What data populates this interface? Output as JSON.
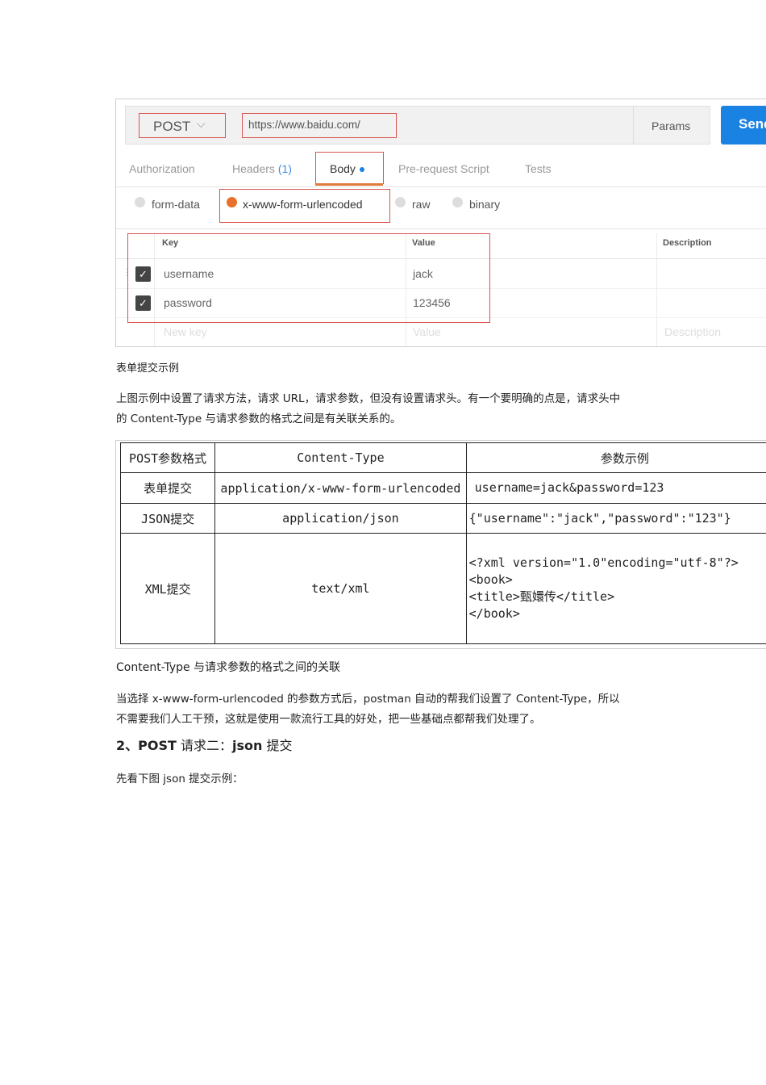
{
  "postman": {
    "method": "POST",
    "url": "https://www.baidu.com/",
    "params": "Params",
    "send": "Send",
    "tabs": [
      "Authorization",
      "Headers",
      "(1)",
      "Body",
      "Pre-request Script",
      "Tests"
    ],
    "body_types": [
      "form-data",
      "x-www-form-urlencoded",
      "raw",
      "binary"
    ],
    "columns": [
      "Key",
      "Value",
      "Description"
    ],
    "rows": [
      {
        "key": "username",
        "value": "jack"
      },
      {
        "key": "password",
        "value": "123456"
      }
    ],
    "new_row": {
      "key": "New key",
      "value": "Value",
      "description": "Description"
    }
  },
  "caption1": "表单提交示例",
  "para1": [
    "上图示例中设置了请求方法，请求 URL，请求参数，但没有设置请求头。有一个要明确的点是，请求头中",
    "的 Content-Type 与请求参数的格式之间是有关联关系的。"
  ],
  "table": {
    "headers": [
      "POST参数格式",
      "Content-Type",
      "参数示例"
    ],
    "rows": [
      [
        "表单提交",
        "application/x-www-form-urlencoded",
        "username=jack&password=123"
      ],
      [
        "JSON提交",
        "application/json",
        "{\"username\":\"jack\",\"password\":\"123\"}"
      ]
    ],
    "xml": {
      "label": "XML提交",
      "type": "text/xml",
      "lines": [
        "<?xml version=\"1.0\"encoding=\"utf-8\"?>",
        "<book>",
        "<title>甄嬛传</title>",
        "</book>"
      ]
    }
  },
  "caption2": "Content-Type 与请求参数的格式之间的关联",
  "para2": [
    "当选择 x-www-form-urlencoded 的参数方式后，postman 自动的帮我们设置了 Content-Type，所以",
    "不需要我们人工干预，这就是使用一款流行工具的好处，把一些基础点都帮我们处理了。"
  ],
  "heading": {
    "num": "2、POST",
    "mid": " 请求二：",
    "bold": "json",
    "end": " 提交"
  },
  "para3": "先看下图 json 提交示例："
}
